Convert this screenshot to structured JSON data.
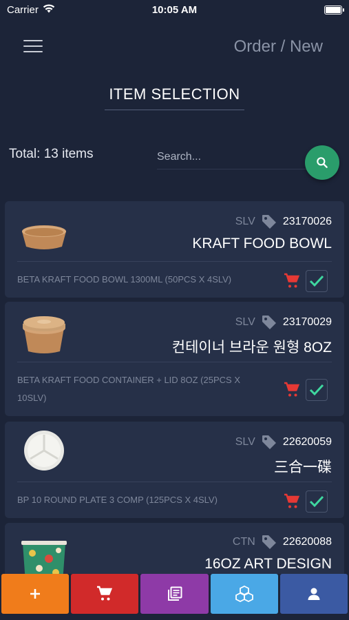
{
  "status_bar": {
    "carrier": "Carrier",
    "time": "10:05 AM"
  },
  "header": {
    "title": "Order / New"
  },
  "section": {
    "title": "ITEM SELECTION"
  },
  "search": {
    "total": "Total: 13 items",
    "placeholder": "Search..."
  },
  "items": [
    {
      "unit": "SLV",
      "code": "23170026",
      "name": "KRAFT FOOD BOWL",
      "description": "BETA KRAFT FOOD BOWL 1300ML (50PCS X 4SLV)",
      "image": "kraft-bowl"
    },
    {
      "unit": "SLV",
      "code": "23170029",
      "name": "컨테이너 브라운 원형 8OZ",
      "description": "BETA KRAFT FOOD CONTAINER + LID 8OZ (25PCS X 10SLV)",
      "image": "kraft-container-lid"
    },
    {
      "unit": "SLV",
      "code": "22620059",
      "name": "三合一碟",
      "description": "BP 10 ROUND PLATE 3 COMP (125PCS X 4SLV)",
      "image": "round-plate"
    },
    {
      "unit": "CTN",
      "code": "22620088",
      "name": "16OZ ART DESIGN",
      "description": "",
      "image": "art-cup"
    }
  ],
  "bottom_nav": [
    {
      "name": "add",
      "icon": "plus-icon",
      "color": "#f07c1b"
    },
    {
      "name": "cart",
      "icon": "cart-icon",
      "color": "#d12a2a"
    },
    {
      "name": "catalog",
      "icon": "library-icon",
      "color": "#8e3aa7"
    },
    {
      "name": "products",
      "icon": "cubes-icon",
      "color": "#4aa8e6"
    },
    {
      "name": "account",
      "icon": "person-icon",
      "color": "#3b5aa3"
    }
  ],
  "colors": {
    "background": "#1c2438",
    "card": "#263048",
    "search_button": "#2a9d6b",
    "check": "#3fd8a0",
    "cart": "#e53935"
  }
}
